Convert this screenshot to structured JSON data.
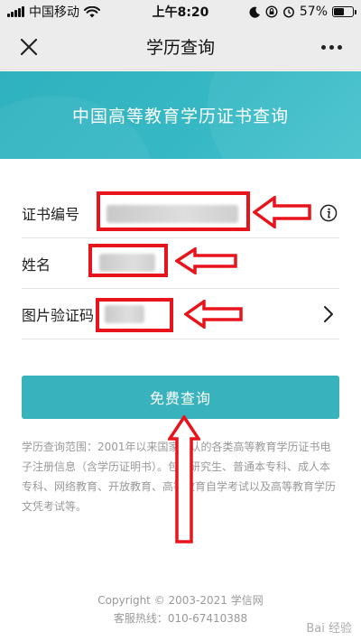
{
  "status_bar": {
    "carrier": "中国移动",
    "time": "上午8:20",
    "battery_percent": "57%",
    "battery_level": 0.57
  },
  "nav": {
    "title": "学历查询"
  },
  "banner": {
    "title": "中国高等教育学历证书查询"
  },
  "form": {
    "rows": [
      {
        "label": "证书编号"
      },
      {
        "label": "姓名"
      },
      {
        "label": "图片验证码"
      }
    ],
    "submit_label": "免费查询"
  },
  "description": "学历查询范围：2001年以来国家承认的各类高等教育学历证书电子注册信息（含学历证明书）。包括研究生、普通本专科、成人本专科、网络教育、开放教育、高等教育自学考试以及高等教育学历文凭考试等。",
  "footer": {
    "copyright": "Copyright © 2003-2021 学信网",
    "hotline": "客服热线：010-67410388"
  },
  "watermark": "Bai 经验",
  "colors": {
    "accent": "#38b2bd",
    "annotation": "#e8141c"
  }
}
